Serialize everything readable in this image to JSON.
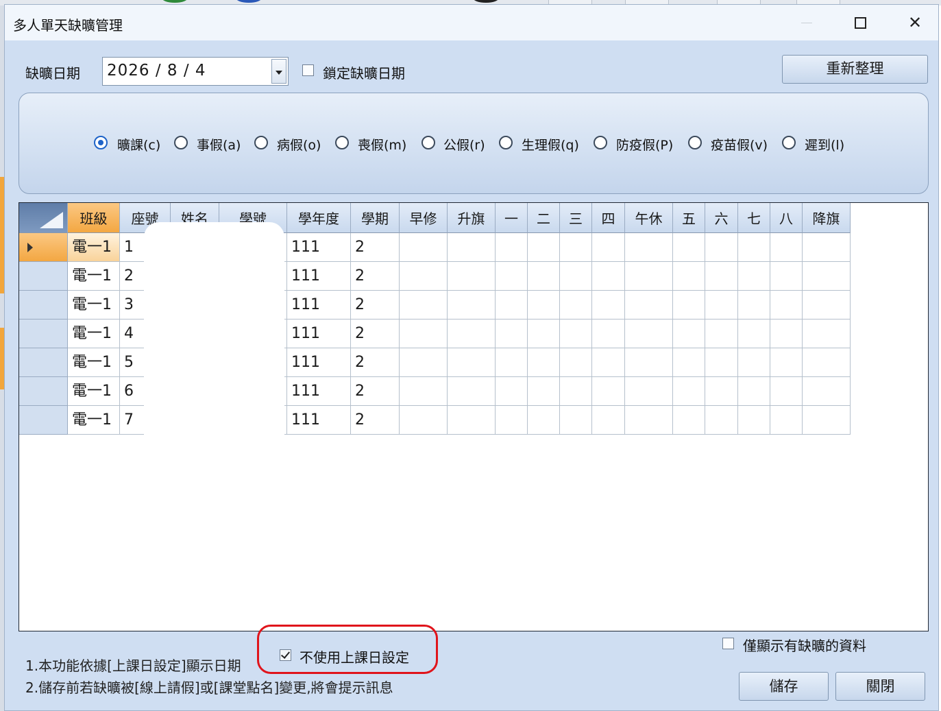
{
  "window": {
    "title": "多人單天缺曠管理"
  },
  "date_row": {
    "label": "缺曠日期",
    "date_value": "2026 / 8 / 4",
    "lock_label": "鎖定缺曠日期",
    "lock_checked": false,
    "refresh_button": "重新整理"
  },
  "absence_types": [
    {
      "label": "曠課(c)",
      "selected": true
    },
    {
      "label": "事假(a)",
      "selected": false
    },
    {
      "label": "病假(o)",
      "selected": false
    },
    {
      "label": "喪假(m)",
      "selected": false
    },
    {
      "label": "公假(r)",
      "selected": false
    },
    {
      "label": "生理假(q)",
      "selected": false
    },
    {
      "label": "防疫假(P)",
      "selected": false
    },
    {
      "label": "疫苗假(v)",
      "selected": false
    },
    {
      "label": "遲到(l)",
      "selected": false
    }
  ],
  "grid": {
    "columns": [
      "班級",
      "座號",
      "姓名",
      "學號",
      "學年度",
      "學期",
      "早修",
      "升旗",
      "一",
      "二",
      "三",
      "四",
      "午休",
      "五",
      "六",
      "七",
      "八",
      "降旗"
    ],
    "rows": [
      [
        "電一1",
        "1",
        "",
        "",
        "111",
        "2",
        "",
        "",
        "",
        "",
        "",
        "",
        "",
        "",
        "",
        "",
        "",
        ""
      ],
      [
        "電一1",
        "2",
        "",
        "",
        "111",
        "2",
        "",
        "",
        "",
        "",
        "",
        "",
        "",
        "",
        "",
        "",
        "",
        ""
      ],
      [
        "電一1",
        "3",
        "",
        "",
        "111",
        "2",
        "",
        "",
        "",
        "",
        "",
        "",
        "",
        "",
        "",
        "",
        "",
        ""
      ],
      [
        "電一1",
        "4",
        "",
        "",
        "111",
        "2",
        "",
        "",
        "",
        "",
        "",
        "",
        "",
        "",
        "",
        "",
        "",
        ""
      ],
      [
        "電一1",
        "5",
        "",
        "",
        "111",
        "2",
        "",
        "",
        "",
        "",
        "",
        "",
        "",
        "",
        "",
        "",
        "",
        ""
      ],
      [
        "電一1",
        "6",
        "",
        "",
        "111",
        "2",
        "",
        "",
        "",
        "",
        "",
        "",
        "",
        "",
        "",
        "",
        "",
        ""
      ],
      [
        "電一1",
        "7",
        "",
        "",
        "111",
        "2",
        "",
        "",
        "",
        "",
        "",
        "",
        "",
        "",
        "",
        "",
        "",
        ""
      ]
    ]
  },
  "footer": {
    "only_absent_label": "僅顯示有缺曠的資料",
    "only_absent_checked": false,
    "no_school_day_label": "不使用上課日設定",
    "no_school_day_checked": true,
    "note1": "1.本功能依據[上課日設定]顯示日期",
    "note2": "2.儲存前若缺曠被[線上請假]或[課堂點名]變更,將會提示訊息",
    "save_button": "儲存",
    "close_button": "關閉"
  },
  "colors": {
    "window_bg": "#cfdef2",
    "selected_header": "#f3a742",
    "highlight": "#e0141b",
    "radio_selected": "#1e63c8"
  }
}
